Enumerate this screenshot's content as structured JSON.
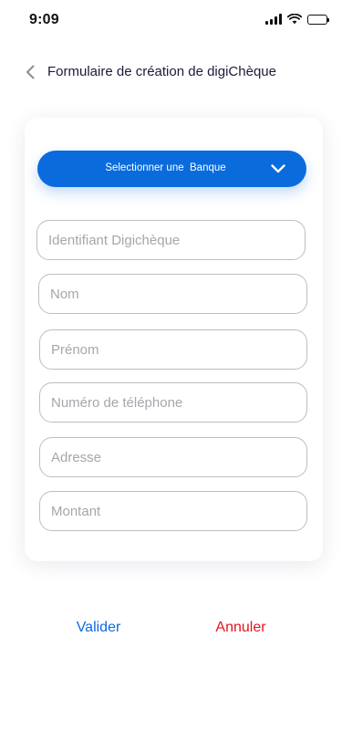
{
  "status_bar": {
    "time": "9:09",
    "icons": [
      "signal-icon",
      "wifi-icon",
      "battery-icon"
    ]
  },
  "header": {
    "back_icon": "chevron-left-icon",
    "title": "Formulaire de création de digiChèque"
  },
  "form": {
    "bank_select": {
      "label": "Selectionner une  Banque",
      "icon": "chevron-down-icon"
    },
    "fields": {
      "identifiant": {
        "placeholder": "Identifiant Digichèque",
        "value": ""
      },
      "nom": {
        "placeholder": "Nom",
        "value": ""
      },
      "prenom": {
        "placeholder": "Prénom",
        "value": ""
      },
      "telephone": {
        "placeholder": "Numéro de téléphone",
        "value": ""
      },
      "adresse": {
        "placeholder": "Adresse",
        "value": ""
      },
      "montant": {
        "placeholder": "Montant",
        "value": ""
      }
    }
  },
  "actions": {
    "validate_label": "Valider",
    "cancel_label": "Annuler"
  },
  "colors": {
    "primary": "#0a6bdc",
    "danger": "#e01522",
    "title": "#1b1b3a",
    "placeholder": "#a6a6ad",
    "border": "#bdbdc4"
  }
}
